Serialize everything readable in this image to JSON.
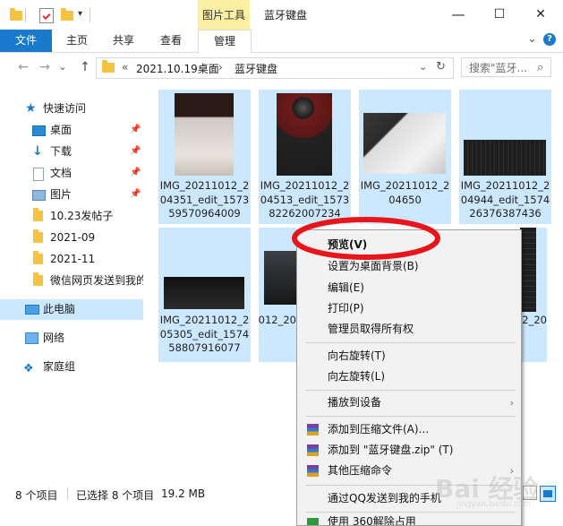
{
  "window": {
    "context_tab_label": "图片工具",
    "title": "蓝牙键盘",
    "minimize_glyph": "—",
    "maximize_glyph": "☐",
    "close_glyph": "✕"
  },
  "ribbon": {
    "tabs": [
      {
        "label": "文件"
      },
      {
        "label": "主页"
      },
      {
        "label": "共享"
      },
      {
        "label": "查看"
      },
      {
        "label": "管理"
      }
    ],
    "collapse_glyph": "⌄",
    "help_glyph": "?"
  },
  "address": {
    "back_glyph": "←",
    "forward_glyph": "→",
    "recent_glyph": "⌄",
    "up_glyph": "↑",
    "overflow": "«",
    "crumbs": [
      "2021.10.19桌面",
      "蓝牙键盘"
    ],
    "crumb_sep": "›",
    "dropdown_glyph": "⌄",
    "refresh_glyph": "↻",
    "search_placeholder": "搜索\"蓝牙...",
    "search_glyph": "⌕"
  },
  "nav": {
    "items": [
      {
        "label": "快速访问"
      },
      {
        "label": "桌面"
      },
      {
        "label": "下载"
      },
      {
        "label": "文档"
      },
      {
        "label": "图片"
      },
      {
        "label": "10.23发帖子"
      },
      {
        "label": "2021-09"
      },
      {
        "label": "2021-11"
      },
      {
        "label": "微信网页发送到我的"
      },
      {
        "label": "此电脑"
      },
      {
        "label": "网络"
      },
      {
        "label": "家庭组"
      }
    ]
  },
  "files": [
    {
      "name": "IMG_20211012_204351_edit_157359570964009"
    },
    {
      "name": "IMG_20211012_204513_edit_157382262007234"
    },
    {
      "name": "IMG_20211012_204650"
    },
    {
      "name": "IMG_20211012_204944_edit_157426376387436"
    },
    {
      "name": "IMG_20211012_205305_edit_157458807916077"
    },
    {
      "name": "IMG_20211012_20"
    },
    {
      "name": ""
    },
    {
      "name": "IMG_20211012_20"
    }
  ],
  "status": {
    "item_count": "8 个项目",
    "selected": "已选择 8 个项目",
    "size": "19.2 MB"
  },
  "context_menu": {
    "items": [
      {
        "label": "预览(V)"
      },
      {
        "label": "设置为桌面背景(B)"
      },
      {
        "label": "编辑(E)"
      },
      {
        "label": "打印(P)"
      },
      {
        "label": "管理员取得所有权"
      },
      {
        "label": "向右旋转(T)"
      },
      {
        "label": "向左旋转(L)"
      },
      {
        "label": "播放到设备"
      },
      {
        "label": "添加到压缩文件(A)..."
      },
      {
        "label": "添加到 \"蓝牙键盘.zip\" (T)"
      },
      {
        "label": "其他压缩命令"
      },
      {
        "label": "通过QQ发送到我的手机"
      },
      {
        "label": "使用 360解除占用"
      }
    ],
    "submenu_glyph": "›"
  },
  "watermark": {
    "text": "Bai 经验",
    "sub": "jingyan.baidu.com"
  },
  "colors": {
    "accent": "#1979ca",
    "selection": "#cce8ff",
    "context_tab": "#fcefa1",
    "annotation": "#e8151b"
  }
}
